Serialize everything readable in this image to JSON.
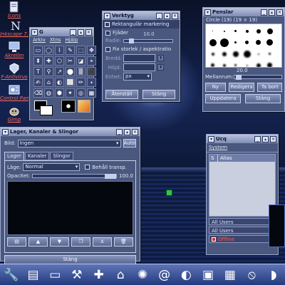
{
  "desktop": {
    "icons": [
      {
        "label": "Icons",
        "icon": "document-icon"
      },
      {
        "label": "Inkscape 7.0",
        "icon": "inkscape-icon"
      },
      {
        "label": "Akrellm",
        "icon": "monitor-icon"
      },
      {
        "label": "F-Antivirus",
        "icon": "antivirus-icon"
      },
      {
        "label": "Control Panel",
        "icon": "control-panel-icon"
      },
      {
        "label": "Gimp",
        "icon": "gimp-icon"
      }
    ]
  },
  "toolbox": {
    "title": "G",
    "menu": [
      "Arkiv",
      "Xtns",
      "Hjälp"
    ],
    "tools": [
      "▭",
      "◯",
      "⌇",
      "✎",
      "⬚",
      "✥",
      "⬍",
      "✚",
      "⬡",
      "✂",
      "◪",
      "⌖",
      "T",
      "⚲",
      "↗",
      "⬤",
      "▒",
      "⬛",
      "✍",
      "⌂",
      "◐",
      "⬜",
      "✏",
      "⬩",
      "⌫",
      "◍",
      "⬢",
      "✦",
      "◎",
      "▦"
    ]
  },
  "tool_options": {
    "title": "Verktyg",
    "mode_label": "Rektangulär markering",
    "feather_label": "Fjäder",
    "radius_label": "Radie:",
    "radius_value": "10.0",
    "fixed_label": "Fix storlek / aspektratio",
    "width_label": "Bredd:",
    "height_label": "Höjd:",
    "unit_label": "Enhet:",
    "unit_value": "px",
    "restore_btn": "Återställ",
    "close_btn": "Stäng"
  },
  "brushes": {
    "title": "Penslar",
    "brush_info": "Circle (19)  (19 × 19)",
    "spacing_value": "20.0",
    "spacing_label": "Mellanrum:",
    "new_btn": "Ny",
    "edit_btn": "Redigera",
    "delete_btn": "Ta bort",
    "refresh_btn": "Uppdatera",
    "close_btn": "Stäng"
  },
  "layers": {
    "title": "Lager, Kanaler & Slingor",
    "image_label": "Bild:",
    "image_value": "Ingen",
    "auto_btn": "Auto",
    "tabs": [
      "Lager",
      "Kanaler",
      "Slingor"
    ],
    "mode_label": "Läge:",
    "mode_value": "Normal",
    "keep_trans_label": "Behåll transp.",
    "opacity_label": "Opacitet:",
    "opacity_value": "100.0",
    "close_btn": "Stäng"
  },
  "users": {
    "title": "Ucq",
    "menu_label": "System",
    "column_s": "S",
    "column_alias": "Alias",
    "group1": "All Users",
    "group2": "All Users",
    "status_item": "Offline"
  },
  "taskbar": {
    "items": [
      {
        "icon": "wrench-icon",
        "glyph": "🔧"
      },
      {
        "icon": "calendar-icon",
        "glyph": "▤"
      },
      {
        "icon": "window-icon",
        "glyph": "▭"
      },
      {
        "icon": "tools-icon",
        "glyph": "⚒"
      },
      {
        "icon": "add-icon",
        "glyph": "✚"
      },
      {
        "icon": "home-icon",
        "glyph": "⌂"
      },
      {
        "icon": "settings-icon",
        "glyph": "✺"
      },
      {
        "icon": "email-icon",
        "glyph": "@"
      },
      {
        "icon": "globe-icon",
        "glyph": "◐"
      },
      {
        "icon": "package-icon",
        "glyph": "▣"
      },
      {
        "icon": "display-icon",
        "glyph": "▦"
      },
      {
        "icon": "no-entry-icon",
        "glyph": "⦸"
      },
      {
        "icon": "speaker-icon",
        "glyph": "◗"
      }
    ]
  }
}
